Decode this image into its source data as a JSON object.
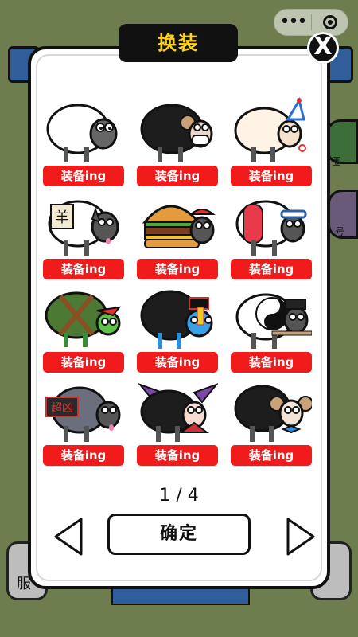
{
  "capsule": {
    "more_icon": "more-dots-icon",
    "close_icon": "target-icon"
  },
  "dialog": {
    "title": "换装",
    "close_label": "X",
    "pager": "1 / 4",
    "confirm_label": "确定"
  },
  "background": {
    "right_badge_1": "圈",
    "right_badge_2": "号",
    "bottom_left_text": "服"
  },
  "skins": [
    {
      "name": "classic-sheep",
      "button": "装备ing"
    },
    {
      "name": "black-sheep-with-horns",
      "button": "装备ing"
    },
    {
      "name": "party-hat-sheep",
      "button": "装备ing"
    },
    {
      "name": "wolf-with-sign-sheep",
      "button": "装备ing"
    },
    {
      "name": "burger-sheep",
      "button": "装备ing"
    },
    {
      "name": "sailor-sheep",
      "button": "装备ing"
    },
    {
      "name": "turtle-sheep",
      "button": "装备ing"
    },
    {
      "name": "jiangshi-black-sheep",
      "button": "装备ing"
    },
    {
      "name": "yin-yang-sheep",
      "button": "装备ing"
    },
    {
      "name": "super-fierce-wolf-sheep",
      "button": "装备ing"
    },
    {
      "name": "vampire-sheep",
      "button": "装备ing"
    },
    {
      "name": "ram-with-bowtie-sheep",
      "button": "装备ing"
    }
  ],
  "sign_text": {
    "sheep_char": "羊",
    "super_fierce": "超凶"
  },
  "colors": {
    "equip_button": "#f21b1b",
    "title_text": "#ffd21a",
    "background": "#6d7d4e"
  }
}
